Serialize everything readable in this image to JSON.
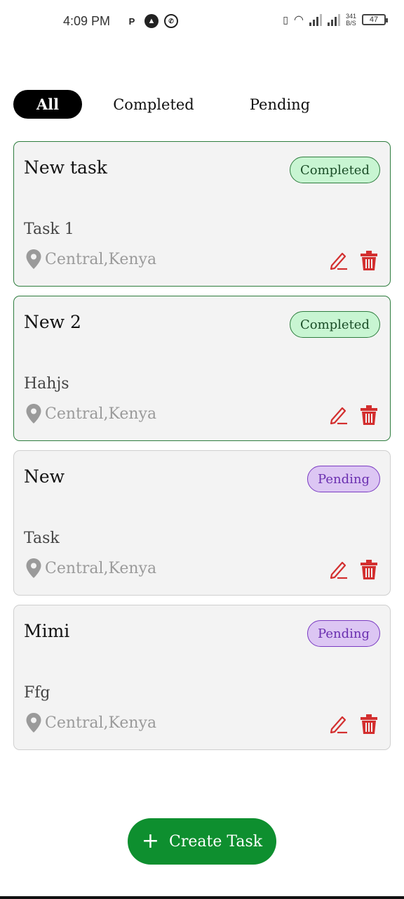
{
  "status_bar": {
    "time": "4:09 PM",
    "speed_top": "341",
    "speed_bottom": "B/S",
    "battery": "47"
  },
  "tabs": [
    {
      "label": "All",
      "active": true
    },
    {
      "label": "Completed",
      "active": false
    },
    {
      "label": "Pending",
      "active": false
    }
  ],
  "tasks": [
    {
      "title": "New task",
      "status": "Completed",
      "description": "Task 1",
      "location": "Central,Kenya"
    },
    {
      "title": "New 2",
      "status": "Completed",
      "description": "Hahjs",
      "location": "Central,Kenya"
    },
    {
      "title": "New",
      "status": "Pending",
      "description": "Task",
      "location": "Central,Kenya"
    },
    {
      "title": "Mimi",
      "status": "Pending",
      "description": "Ffg",
      "location": "Central,Kenya"
    }
  ],
  "create_button": {
    "label": "Create Task"
  },
  "colors": {
    "completed_border": "#2e7d3e",
    "completed_badge_bg": "#c8f5d2",
    "pending_badge_bg": "#dcc6f3",
    "pending_text": "#6a2fb0",
    "action_red": "#d32f2f",
    "create_green": "#0e8f2f"
  },
  "icons": [
    "location-pin-icon",
    "edit-pencil-icon",
    "trash-icon",
    "plus-icon"
  ]
}
